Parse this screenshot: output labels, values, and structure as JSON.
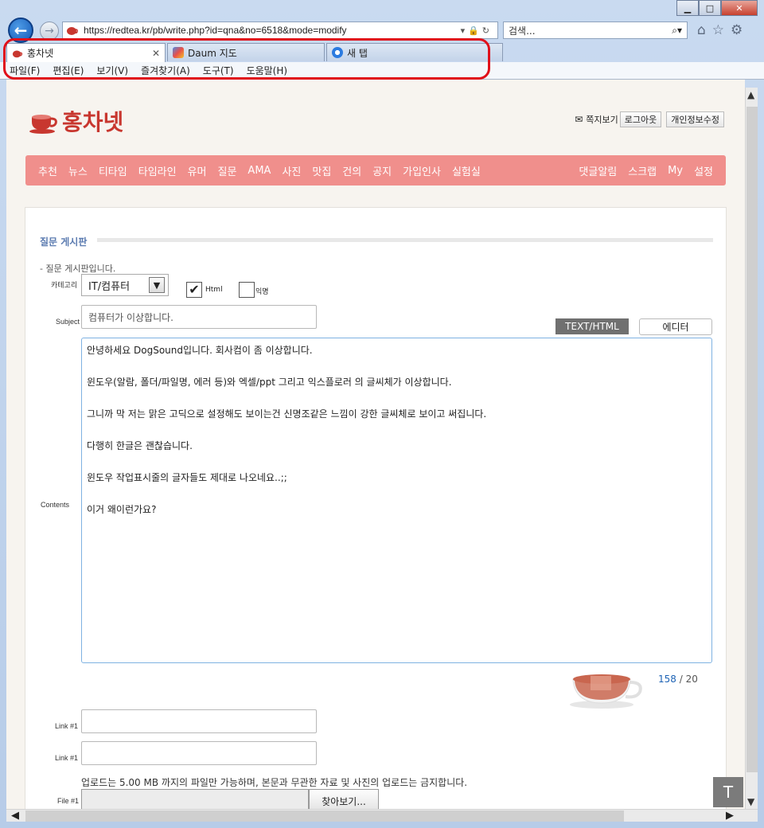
{
  "window": {
    "buttons": {
      "minimize": "▁",
      "maximize": "□",
      "close": "✕"
    }
  },
  "nav": {
    "url": "https://redtea.kr/pb/write.php?id=qna&no=6518&mode=modify",
    "search_placeholder": "검색..."
  },
  "tabs": [
    {
      "label": "홍차넷",
      "active": true
    },
    {
      "label": "Daum 지도",
      "active": false
    },
    {
      "label": "새 탭",
      "active": false
    }
  ],
  "menu": [
    "파일(F)",
    "편집(E)",
    "보기(V)",
    "즐겨찾기(A)",
    "도구(T)",
    "도움말(H)"
  ],
  "site": {
    "logo_text": "홍차넷",
    "user_links": {
      "messages": "쪽지보기",
      "logout": "로그아웃",
      "edit_profile": "개인정보수정"
    },
    "nav_left": [
      "추천",
      "뉴스",
      "티타임",
      "타임라인",
      "유머",
      "질문",
      "AMA",
      "사진",
      "맛집",
      "건의",
      "공지",
      "가입인사",
      "실험실"
    ],
    "nav_right": [
      "댓글알림",
      "스크랩",
      "My",
      "설정"
    ]
  },
  "board": {
    "title": "질문 게시판",
    "description": "- 질문 게시판입니다."
  },
  "form": {
    "category_label": "카테고리",
    "category_value": "IT/컴퓨터",
    "html_label": "Html",
    "secret_label": "익명",
    "subject_label": "Subject",
    "subject_value": "컴퓨터가 이상합니다.",
    "btn_texthtml": "TEXT/HTML",
    "btn_editor": "에디터",
    "contents_label": "Contents",
    "contents_lines": [
      "안녕하세요 DogSound입니다. 회사컴이 좀 이상합니다.",
      "윈도우(알람, 폴더/파일명, 에러 등)와 엑셀/ppt 그리고 익스플로러 의 글씨체가 이상합니다.",
      "그니까 막 저는 맑은 고딕으로 설정해도 보이는건 신명조같은 느낌이 강한 글씨체로 보이고 써집니다.",
      "다행히 한글은 괜찮습니다.",
      "윈도우 작업표시줄의 글자들도 제대로 나오네요..;;",
      "이거 왜이런가요?"
    ],
    "counter_current": "158",
    "counter_sep": " / 20",
    "link1_label": "Link #1",
    "link2_label": "Link #1",
    "upload_note": "업로드는 5.00 MB 까지의 파일만 가능하며, 본문과 무관한 자료 및 사진의 업로드는 금지합니다.",
    "file_label": "File #1",
    "file_button": "찾아보기...",
    "top_button": "T"
  },
  "colors": {
    "brand_red": "#c8372f",
    "nav_pink": "#f08f8c",
    "annotation_red": "#e0101a"
  }
}
